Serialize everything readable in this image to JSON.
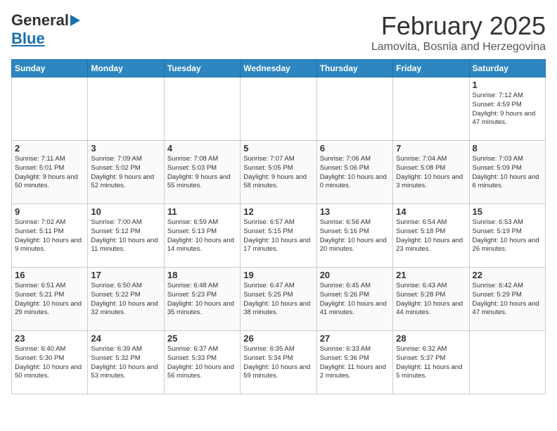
{
  "header": {
    "logo_line1": "General",
    "logo_line2": "Blue",
    "month_title": "February 2025",
    "location": "Lamovita, Bosnia and Herzegovina"
  },
  "weekdays": [
    "Sunday",
    "Monday",
    "Tuesday",
    "Wednesday",
    "Thursday",
    "Friday",
    "Saturday"
  ],
  "weeks": [
    [
      {
        "day": "",
        "info": "",
        "empty": true
      },
      {
        "day": "",
        "info": "",
        "empty": true
      },
      {
        "day": "",
        "info": "",
        "empty": true
      },
      {
        "day": "",
        "info": "",
        "empty": true
      },
      {
        "day": "",
        "info": "",
        "empty": true
      },
      {
        "day": "",
        "info": "",
        "empty": true
      },
      {
        "day": "1",
        "info": "Sunrise: 7:12 AM\nSunset: 4:59 PM\nDaylight: 9 hours and 47 minutes."
      }
    ],
    [
      {
        "day": "2",
        "info": "Sunrise: 7:11 AM\nSunset: 5:01 PM\nDaylight: 9 hours and 50 minutes."
      },
      {
        "day": "3",
        "info": "Sunrise: 7:09 AM\nSunset: 5:02 PM\nDaylight: 9 hours and 52 minutes."
      },
      {
        "day": "4",
        "info": "Sunrise: 7:08 AM\nSunset: 5:03 PM\nDaylight: 9 hours and 55 minutes."
      },
      {
        "day": "5",
        "info": "Sunrise: 7:07 AM\nSunset: 5:05 PM\nDaylight: 9 hours and 58 minutes."
      },
      {
        "day": "6",
        "info": "Sunrise: 7:06 AM\nSunset: 5:06 PM\nDaylight: 10 hours and 0 minutes."
      },
      {
        "day": "7",
        "info": "Sunrise: 7:04 AM\nSunset: 5:08 PM\nDaylight: 10 hours and 3 minutes."
      },
      {
        "day": "8",
        "info": "Sunrise: 7:03 AM\nSunset: 5:09 PM\nDaylight: 10 hours and 6 minutes."
      }
    ],
    [
      {
        "day": "9",
        "info": "Sunrise: 7:02 AM\nSunset: 5:11 PM\nDaylight: 10 hours and 9 minutes."
      },
      {
        "day": "10",
        "info": "Sunrise: 7:00 AM\nSunset: 5:12 PM\nDaylight: 10 hours and 11 minutes."
      },
      {
        "day": "11",
        "info": "Sunrise: 6:59 AM\nSunset: 5:13 PM\nDaylight: 10 hours and 14 minutes."
      },
      {
        "day": "12",
        "info": "Sunrise: 6:57 AM\nSunset: 5:15 PM\nDaylight: 10 hours and 17 minutes."
      },
      {
        "day": "13",
        "info": "Sunrise: 6:56 AM\nSunset: 5:16 PM\nDaylight: 10 hours and 20 minutes."
      },
      {
        "day": "14",
        "info": "Sunrise: 6:54 AM\nSunset: 5:18 PM\nDaylight: 10 hours and 23 minutes."
      },
      {
        "day": "15",
        "info": "Sunrise: 6:53 AM\nSunset: 5:19 PM\nDaylight: 10 hours and 26 minutes."
      }
    ],
    [
      {
        "day": "16",
        "info": "Sunrise: 6:51 AM\nSunset: 5:21 PM\nDaylight: 10 hours and 29 minutes."
      },
      {
        "day": "17",
        "info": "Sunrise: 6:50 AM\nSunset: 5:22 PM\nDaylight: 10 hours and 32 minutes."
      },
      {
        "day": "18",
        "info": "Sunrise: 6:48 AM\nSunset: 5:23 PM\nDaylight: 10 hours and 35 minutes."
      },
      {
        "day": "19",
        "info": "Sunrise: 6:47 AM\nSunset: 5:25 PM\nDaylight: 10 hours and 38 minutes."
      },
      {
        "day": "20",
        "info": "Sunrise: 6:45 AM\nSunset: 5:26 PM\nDaylight: 10 hours and 41 minutes."
      },
      {
        "day": "21",
        "info": "Sunrise: 6:43 AM\nSunset: 5:28 PM\nDaylight: 10 hours and 44 minutes."
      },
      {
        "day": "22",
        "info": "Sunrise: 6:42 AM\nSunset: 5:29 PM\nDaylight: 10 hours and 47 minutes."
      }
    ],
    [
      {
        "day": "23",
        "info": "Sunrise: 6:40 AM\nSunset: 5:30 PM\nDaylight: 10 hours and 50 minutes."
      },
      {
        "day": "24",
        "info": "Sunrise: 6:39 AM\nSunset: 5:32 PM\nDaylight: 10 hours and 53 minutes."
      },
      {
        "day": "25",
        "info": "Sunrise: 6:37 AM\nSunset: 5:33 PM\nDaylight: 10 hours and 56 minutes."
      },
      {
        "day": "26",
        "info": "Sunrise: 6:35 AM\nSunset: 5:34 PM\nDaylight: 10 hours and 59 minutes."
      },
      {
        "day": "27",
        "info": "Sunrise: 6:33 AM\nSunset: 5:36 PM\nDaylight: 11 hours and 2 minutes."
      },
      {
        "day": "28",
        "info": "Sunrise: 6:32 AM\nSunset: 5:37 PM\nDaylight: 11 hours and 5 minutes."
      },
      {
        "day": "",
        "info": "",
        "empty": true
      }
    ]
  ]
}
